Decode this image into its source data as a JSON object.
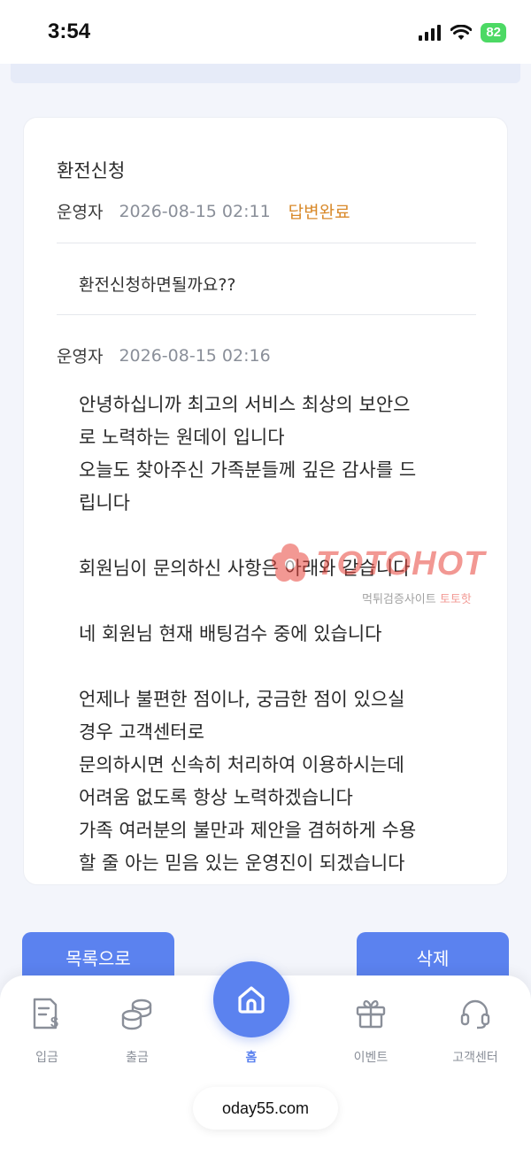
{
  "status_bar": {
    "time": "3:54",
    "battery": "82"
  },
  "post": {
    "title": "환전신청",
    "author": "운영자",
    "date": "2026-08-15 02:11",
    "status": "답변완료",
    "question": "환전신청하면될까요??"
  },
  "reply": {
    "author": "운영자",
    "date": "2026-08-15 02:16",
    "body": "안녕하십니까 최고의 서비스 최상의 보안으\n로 노력하는 원데이 입니다\n오늘도 찾아주신 가족분들께 깊은 감사를 드\n립니다\n\n회원님이 문의하신 사항은 아래와 같습니다\n\n네 회원님 현재 배팅검수 중에 있습니다\n\n언제나 불편한 점이나, 궁금한 점이 있으실\n경우 고객센터로\n문의하시면 신속히 처리하여 이용하시는데\n어려움 없도록 항상 노력하겠습니다\n가족 여러분의 불만과 제안을 겸허하게 수용\n할 줄 아는 믿음 있는 운영진이 되겠습니다"
  },
  "watermark": {
    "brand": "TOTOHOT",
    "sub_prefix": "먹튀검증사이트",
    "sub_brand": "토토핫"
  },
  "buttons": {
    "list": "목록으로",
    "delete": "삭제"
  },
  "nav": {
    "deposit": "입금",
    "withdraw": "출금",
    "home": "홈",
    "event": "이벤트",
    "support": "고객센터"
  },
  "url": "oday55.com",
  "colors": {
    "accent": "#5b82ef",
    "status": "#d98a2b",
    "watermark": "#e8453c"
  }
}
